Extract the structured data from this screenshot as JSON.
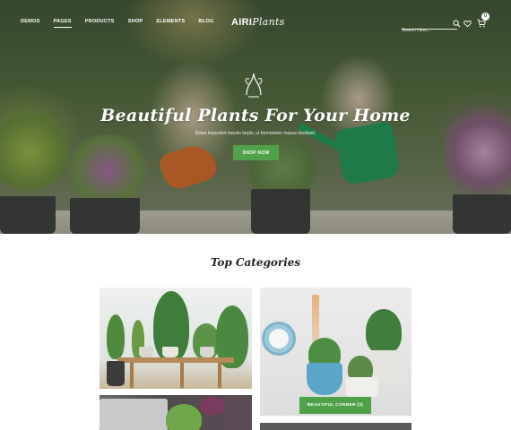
{
  "nav": {
    "items": [
      {
        "label": "DEMOS",
        "active": false
      },
      {
        "label": "PAGES",
        "active": true
      },
      {
        "label": "PRODUCTS",
        "active": false
      },
      {
        "label": "SHOP",
        "active": false
      },
      {
        "label": "ELEMENTS",
        "active": false
      },
      {
        "label": "BLOG",
        "active": false
      }
    ],
    "logo_a": "AIRI",
    "logo_b": "Plants",
    "search_placeholder": "Search Here...",
    "cart_count": "0"
  },
  "hero": {
    "title": "Beautiful Plants For Your Home",
    "subtitle": "Etiam imperdiet mauris turpis, ut fermentum massa tincidunt.",
    "button_label": "SHOP NOW"
  },
  "categories": {
    "title": "Top Categories",
    "cards": [
      {
        "label": ""
      },
      {
        "label": "BEAUTIFUL CORNER (3)"
      },
      {
        "label": ""
      },
      {
        "label": ""
      }
    ]
  },
  "colors": {
    "accent_green": "#4fa14a",
    "text_dark": "#222222"
  },
  "icons": [
    "search-icon",
    "heart-icon",
    "cart-icon",
    "plant-emblem-icon"
  ]
}
